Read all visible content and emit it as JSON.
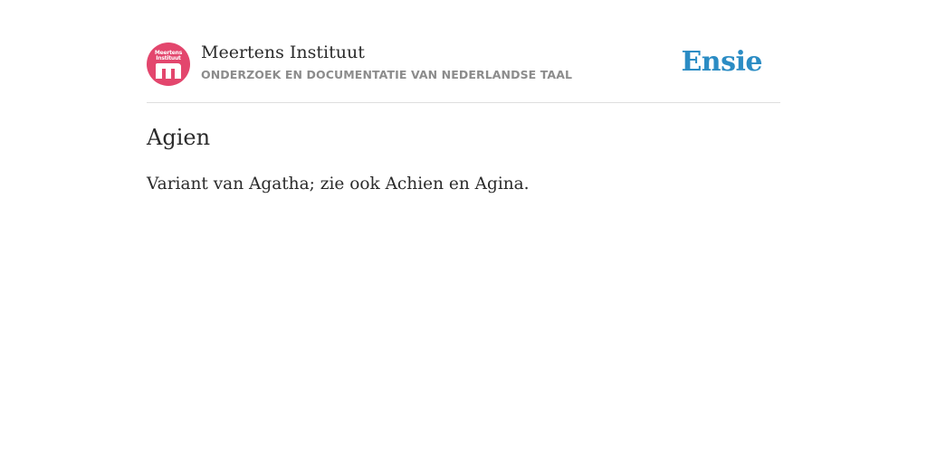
{
  "header": {
    "logo": {
      "icon": "meertens-logo-icon",
      "color": "#e3466d",
      "line1": "Meertens",
      "line2": "Instituut"
    },
    "org_title": "Meertens Instituut",
    "org_subtitle": "ONDERZOEK EN DOCUMENTATIE VAN NEDERLANDSE TAAL",
    "brand": "Ensie",
    "brand_color": "#2b8cc4"
  },
  "entry": {
    "title": "Agien",
    "body": "Variant van Agatha; zie ook Achien en Agina."
  }
}
